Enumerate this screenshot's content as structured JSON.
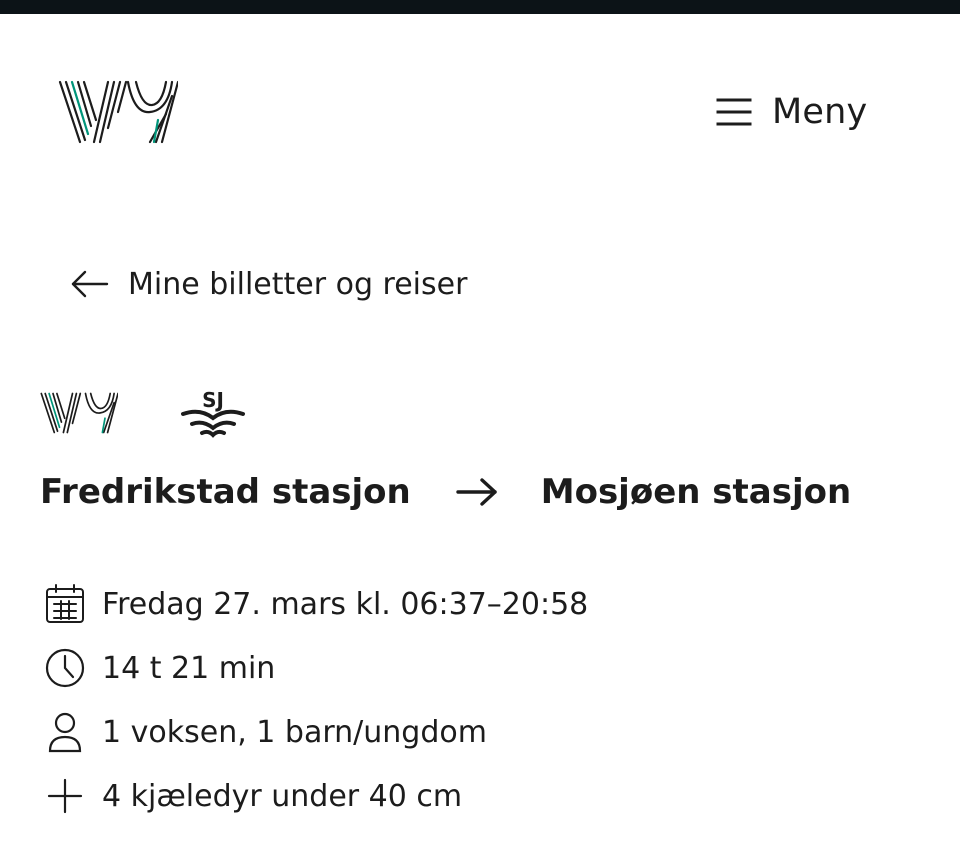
{
  "header": {
    "logo_name": "vy-logo",
    "menu_label": "Meny"
  },
  "navigation": {
    "back_label": "Mine billetter og reiser"
  },
  "trip": {
    "operators": [
      "Vy",
      "SJ"
    ],
    "from": "Fredrikstad stasjon",
    "to": "Mosjøen stasjon",
    "details": [
      {
        "icon": "calendar-icon",
        "text": "Fredag 27. mars kl. 06:37–20:58"
      },
      {
        "icon": "clock-icon",
        "text": "14 t 21 min"
      },
      {
        "icon": "person-icon",
        "text": "1 voksen, 1 barn/ungdom"
      },
      {
        "icon": "plus-icon",
        "text": "4 kjæledyr under 40 cm"
      }
    ]
  },
  "colors": {
    "text": "#1c1c1c",
    "accent": "#00957a",
    "top_strip": "#0c1317",
    "background": "#ffffff"
  }
}
